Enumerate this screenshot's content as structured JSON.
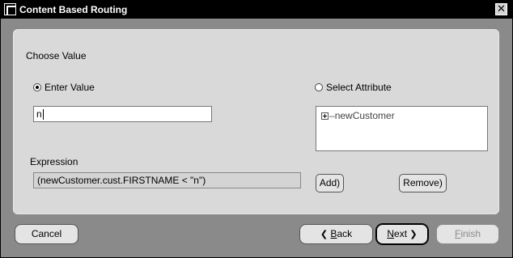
{
  "window": {
    "title": "Content Based Routing",
    "close_glyph": "✕"
  },
  "panel": {
    "section_label": "Choose Value",
    "enter_value": {
      "label": "Enter Value",
      "checked": true,
      "value": "n"
    },
    "select_attribute": {
      "label": "Select Attribute",
      "checked": false,
      "tree_root": "newCustomer"
    },
    "expression": {
      "label": "Expression",
      "value": "(newCustomer.cust.FIRSTNAME < \"n\")"
    },
    "add_label": "Add)",
    "remove_label": "Remove)"
  },
  "footer": {
    "cancel_label": "Cancel",
    "back_label": "Back",
    "back_mnemonic": "B",
    "next_label": "Next",
    "next_mnemonic": "N",
    "finish_label": "Finish",
    "finish_mnemonic": "F"
  },
  "icons": {
    "app": "app-icon",
    "close": "close-icon",
    "expand": "expand-icon",
    "back_arrow": "chevron-left-icon",
    "next_arrow": "chevron-right-icon"
  }
}
